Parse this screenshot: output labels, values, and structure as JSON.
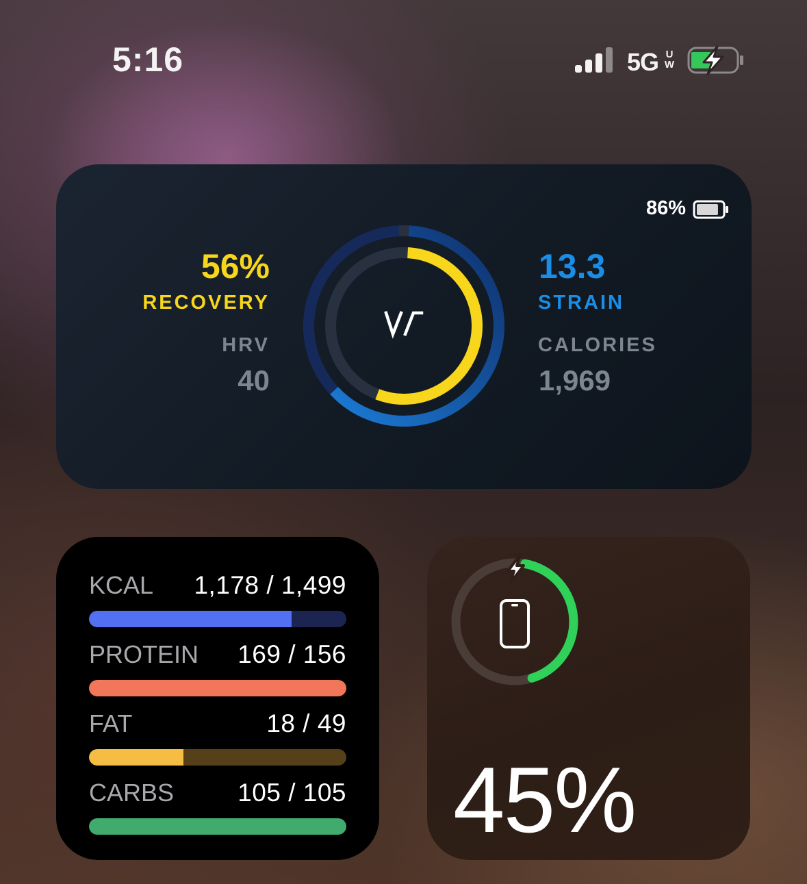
{
  "status_bar": {
    "time": "5:16",
    "network": "5G",
    "network_sub_top": "U",
    "network_sub_bottom": "W",
    "signal_bars": 4,
    "battery_icon": "battery-charging-icon",
    "battery_color": "#34c759"
  },
  "whoop": {
    "device_battery": "86%",
    "device_battery_fraction": 0.86,
    "recovery_value": "56%",
    "recovery_label": "RECOVERY",
    "recovery_fraction": 0.56,
    "hrv_label": "HRV",
    "hrv_value": "40",
    "strain_value": "13.3",
    "strain_label": "STRAIN",
    "strain_max": 21,
    "calories_label": "CALORIES",
    "calories_value": "1,969",
    "logo": "whoop-logo",
    "colors": {
      "recovery": "#f7d61b",
      "strain": "#1a8ee6",
      "muted": "#7d858f"
    }
  },
  "nutrition": {
    "macros": [
      {
        "name": "KCAL",
        "value": "1,178 / 1,499",
        "fraction": 0.786,
        "color": "#5470f2",
        "track": "#1c2552"
      },
      {
        "name": "PROTEIN",
        "value": "169 / 156",
        "fraction": 1.0,
        "color": "#f2775a",
        "track": "#5a2a20"
      },
      {
        "name": "FAT",
        "value": "18 / 49",
        "fraction": 0.367,
        "color": "#f5bd43",
        "track": "#55401a"
      },
      {
        "name": "CARBS",
        "value": "105 / 105",
        "fraction": 1.0,
        "color": "#41ab6e",
        "track": "#1a4a30"
      }
    ]
  },
  "phone_battery": {
    "percent": "45%",
    "fraction": 0.45,
    "ring_color": "#30d158",
    "icon": "iphone-icon",
    "charging_icon": "bolt-icon"
  }
}
